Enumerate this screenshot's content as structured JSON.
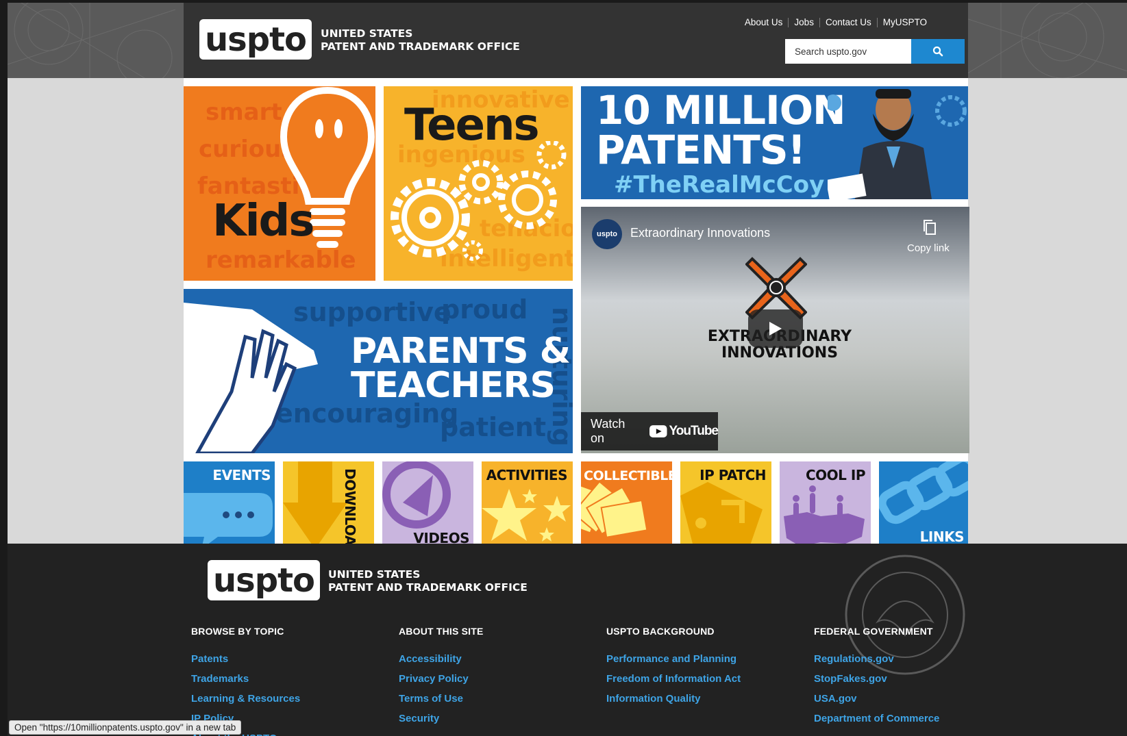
{
  "header": {
    "logo_text": "uspto",
    "agency_line1": "UNITED STATES",
    "agency_line2": "PATENT AND TRADEMARK OFFICE",
    "top_links": [
      "About Us",
      "Jobs",
      "Contact Us",
      "MyUSPTO"
    ],
    "search_placeholder": "Search uspto.gov",
    "search_icon": "search-icon"
  },
  "tiles": {
    "kids": {
      "label": "Kids",
      "words": [
        "smart",
        "curious",
        "fantastic",
        "remarkable"
      ],
      "color": "#f07b1e"
    },
    "teens": {
      "label": "Teens",
      "words": [
        "innovative",
        "ingenious",
        "tenacious",
        "intelligent"
      ],
      "color": "#f7b32b"
    },
    "parents": {
      "label_line1": "PARENTS &",
      "label_line2": "TEACHERS",
      "words": [
        "supportive",
        "proud",
        "nurturing",
        "encouraging",
        "patient"
      ],
      "color": "#1e67b0"
    },
    "million": {
      "line1": "10 MILLION",
      "line2": "PATENTS!",
      "hashtag": "#TheRealMcCoy",
      "color": "#1e67b0"
    }
  },
  "video": {
    "channel_badge": "uspto",
    "title": "Extraordinary Innovations",
    "copy_label": "Copy link",
    "logo_line1": "EXTRAORDINARY",
    "logo_line2": "INNOVATIONS",
    "watch_on": "Watch on",
    "youtube": "YouTube"
  },
  "small_tiles": [
    {
      "label": "EVENTS",
      "color": "#1e7fc8"
    },
    {
      "label": "DOWNLOADS",
      "color": "#f5c52a"
    },
    {
      "label": "VIDEOS",
      "color": "#c9b5de"
    },
    {
      "label": "ACTIVITIES",
      "color": "#f7b32b"
    },
    {
      "label": "COLLECTIBLES",
      "color": "#f07b1e"
    },
    {
      "label": "IP PATCH",
      "color": "#f5c52a"
    },
    {
      "label": "COOL IP",
      "color": "#c9b5de"
    },
    {
      "label": "LINKS",
      "color": "#1e7fc8"
    }
  ],
  "footer": {
    "logo_text": "uspto",
    "agency_line1": "UNITED STATES",
    "agency_line2": "PATENT AND TRADEMARK OFFICE",
    "columns": [
      {
        "heading": "BROWSE BY TOPIC",
        "links": [
          "Patents",
          "Trademarks",
          "Learning & Resources",
          "IP Policy",
          "About the USPTO"
        ]
      },
      {
        "heading": "ABOUT THIS SITE",
        "links": [
          "Accessibility",
          "Privacy Policy",
          "Terms of Use",
          "Security"
        ]
      },
      {
        "heading": "USPTO BACKGROUND",
        "links": [
          "Performance and Planning",
          "Freedom of Information Act",
          "Information Quality"
        ]
      },
      {
        "heading": "FEDERAL GOVERNMENT",
        "links": [
          "Regulations.gov",
          "StopFakes.gov",
          "USA.gov",
          "Department of Commerce"
        ]
      }
    ]
  },
  "status_bar": "Open \"https://10millionpatents.uspto.gov\" in a new tab"
}
